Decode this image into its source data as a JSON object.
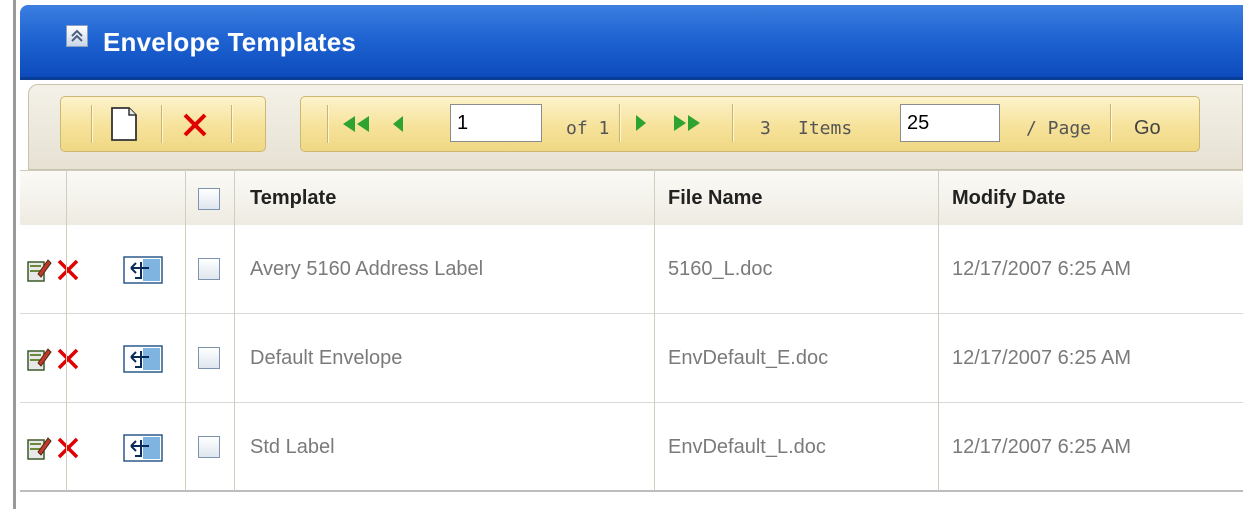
{
  "header": {
    "title": "Envelope Templates",
    "collapse_icon": "double-chevron-up-icon"
  },
  "toolbar": {
    "new_icon": "new-document-icon",
    "delete_icon": "delete-x-icon",
    "first_icon": "first-page-icon",
    "prev_icon": "previous-page-icon",
    "page_value": "1",
    "of_label": "of 1",
    "next_icon": "next-page-icon",
    "last_icon": "last-page-icon",
    "item_count": "3",
    "items_label": "Items",
    "page_size_value": "25",
    "per_page_label": "/ Page",
    "go_label": "Go"
  },
  "table": {
    "columns": [
      "Template",
      "File Name",
      "Modify Date"
    ],
    "rows": [
      {
        "template": "Avery 5160 Address Label",
        "file_name": "5160_L.doc",
        "modify_date": "12/17/2007 6:25 AM"
      },
      {
        "template": "Default Envelope",
        "file_name": "EnvDefault_E.doc",
        "modify_date": "12/17/2007 6:25 AM"
      },
      {
        "template": "Std Label",
        "file_name": "EnvDefault_L.doc",
        "modify_date": "12/17/2007 6:25 AM"
      }
    ],
    "row_icons": [
      "edit-icon",
      "delete-icon",
      "copy-template-icon"
    ]
  },
  "colors": {
    "header_blue": "#1f64d2",
    "toolbar_gold": "#f6e29a",
    "delete_red": "#e00000",
    "nav_green": "#2fa32f"
  }
}
